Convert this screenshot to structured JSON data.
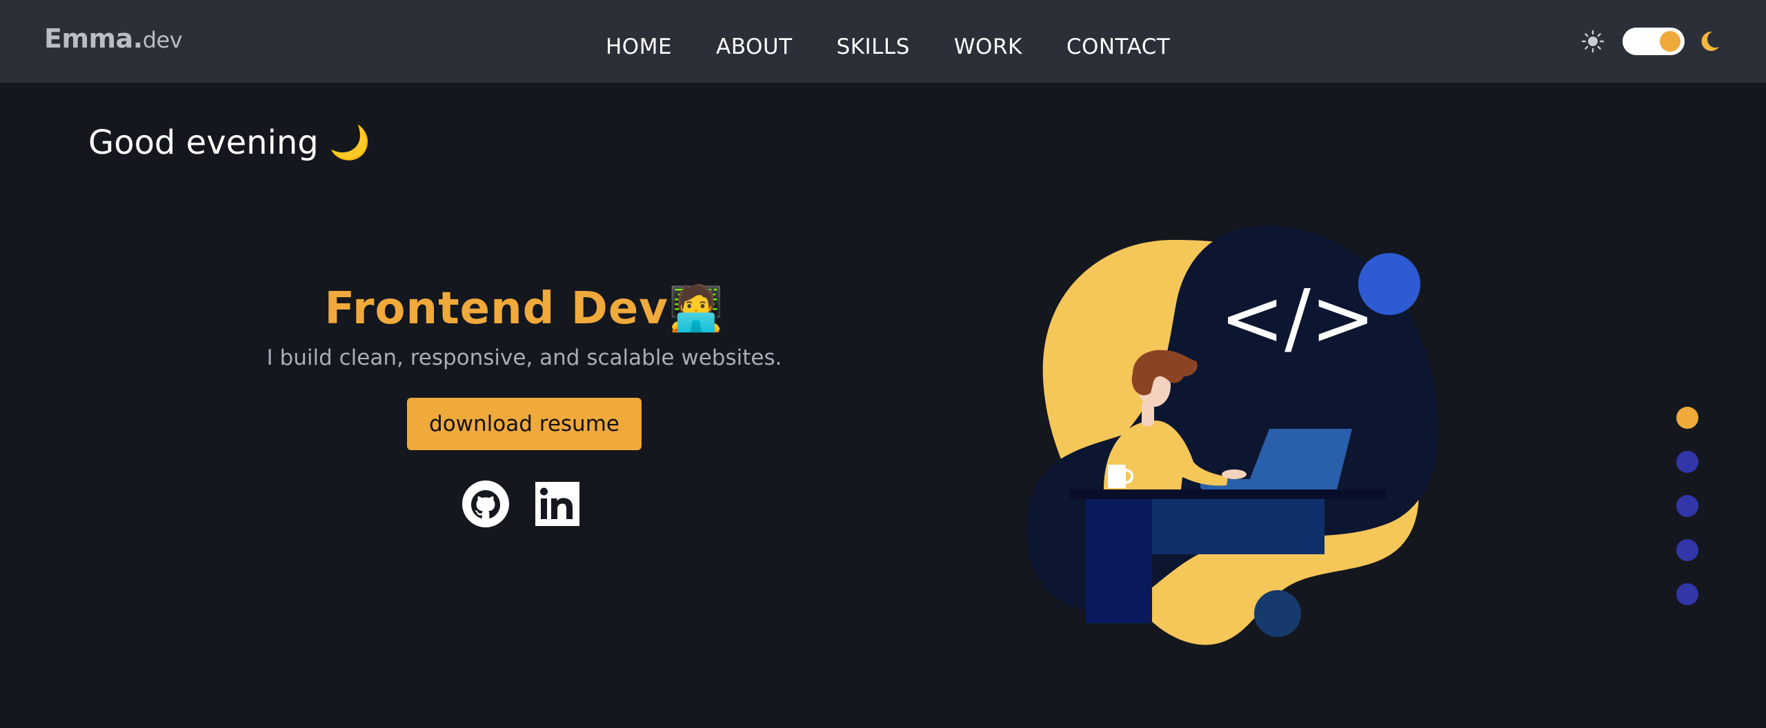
{
  "brand": {
    "name": "Emma.",
    "suffix": "dev"
  },
  "nav": {
    "links": [
      {
        "label": "HOME"
      },
      {
        "label": "ABOUT"
      },
      {
        "label": "SKILLS"
      },
      {
        "label": "WORK"
      },
      {
        "label": "CONTACT"
      }
    ]
  },
  "theme_toggle": {
    "state": "dark",
    "left_icon": "sun-icon",
    "right_icon": "moon-icon"
  },
  "greeting": {
    "text": "Good evening 🌙"
  },
  "hero": {
    "title": "Frontend Dev🧑‍💻",
    "subtitle": "I build clean, responsive, and scalable websites.",
    "button_label": "download resume",
    "social_icons": [
      "github-icon",
      "linkedin-icon"
    ]
  },
  "illustration": {
    "code_text": "</>"
  },
  "section_nav": {
    "count": 5,
    "active_index": 0
  },
  "colors": {
    "accent": "#f0a93b",
    "navbar_bg": "#2b2f38",
    "page_bg": "#14171e",
    "dot_inactive": "#3236a8",
    "text_muted": "#a8adb8"
  }
}
